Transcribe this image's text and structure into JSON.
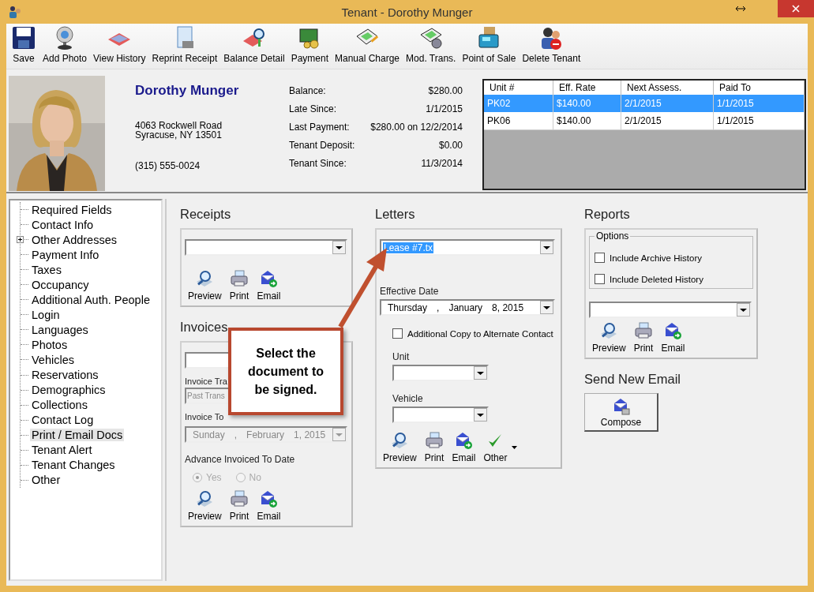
{
  "window": {
    "title": "Tenant - Dorothy Munger"
  },
  "toolbar": [
    {
      "label": "Save"
    },
    {
      "label": "Add Photo"
    },
    {
      "label": "View History"
    },
    {
      "label": "Reprint Receipt"
    },
    {
      "label": "Balance Detail"
    },
    {
      "label": "Payment"
    },
    {
      "label": "Manual Charge"
    },
    {
      "label": "Mod. Trans."
    },
    {
      "label": "Point of Sale"
    },
    {
      "label": "Delete Tenant"
    }
  ],
  "tenant": {
    "name": "Dorothy Munger",
    "address_lines": [
      "4063 Rockwell Road",
      "Syracuse, NY  13501"
    ],
    "phone": "(315) 555-0024"
  },
  "summary": [
    {
      "label": "Balance:",
      "value": "$280.00"
    },
    {
      "label": "Late Since:",
      "value": "1/1/2015"
    },
    {
      "label": "Last Payment:",
      "value": "$280.00 on 12/2/2014"
    },
    {
      "label": "Tenant Deposit:",
      "value": "$0.00"
    },
    {
      "label": "Tenant Since:",
      "value": "11/3/2014"
    }
  ],
  "units": {
    "columns": [
      "Unit #",
      "Eff. Rate",
      "Next Assess.",
      "Paid To"
    ],
    "rows": [
      {
        "cells": [
          "PK02",
          "$140.00",
          "2/1/2015",
          "1/1/2015"
        ],
        "selected": true
      },
      {
        "cells": [
          "PK06",
          "$140.00",
          "2/1/2015",
          "1/1/2015"
        ],
        "selected": false
      }
    ]
  },
  "tree": {
    "items": [
      {
        "label": "Required Fields",
        "kind": "leaf",
        "selected": false
      },
      {
        "label": "Contact Info",
        "kind": "leaf",
        "selected": false
      },
      {
        "label": "Other Addresses",
        "kind": "folder",
        "selected": false
      },
      {
        "label": "Payment Info",
        "kind": "leaf",
        "selected": false
      },
      {
        "label": "Taxes",
        "kind": "leaf",
        "selected": false
      },
      {
        "label": "Occupancy",
        "kind": "leaf",
        "selected": false
      },
      {
        "label": "Additional Auth. People",
        "kind": "leaf",
        "selected": false
      },
      {
        "label": "Login",
        "kind": "leaf",
        "selected": false
      },
      {
        "label": "Languages",
        "kind": "leaf",
        "selected": false
      },
      {
        "label": "Photos",
        "kind": "leaf",
        "selected": false
      },
      {
        "label": "Vehicles",
        "kind": "leaf",
        "selected": false
      },
      {
        "label": "Reservations",
        "kind": "leaf",
        "selected": false
      },
      {
        "label": "Demographics",
        "kind": "leaf",
        "selected": false
      },
      {
        "label": "Collections",
        "kind": "leaf",
        "selected": false
      },
      {
        "label": "Contact Log",
        "kind": "leaf",
        "selected": false
      },
      {
        "label": "Print / Email Docs",
        "kind": "leaf",
        "selected": true
      },
      {
        "label": "Tenant Alert",
        "kind": "leaf",
        "selected": false
      },
      {
        "label": "Tenant Changes",
        "kind": "leaf",
        "selected": false
      },
      {
        "label": "Other",
        "kind": "leaf",
        "selected": false
      }
    ]
  },
  "receipts": {
    "title": "Receipts",
    "buttons": [
      {
        "label": "Preview",
        "kind": "preview"
      },
      {
        "label": "Print",
        "kind": "print"
      },
      {
        "label": "Email",
        "kind": "email"
      }
    ]
  },
  "invoices": {
    "title": "Invoices",
    "transaction_label": "Invoice Tra",
    "transaction_field": {
      "value": "Past Trans",
      "disabled": true
    },
    "to_label": "Invoice To",
    "to_date": {
      "parts": [
        "Sunday",
        ",",
        "February",
        "1, 2015"
      ],
      "disabled": true
    },
    "advance_label": "Advance Invoiced To Date",
    "radios": [
      {
        "label": "Yes",
        "selected": true,
        "disabled": true
      },
      {
        "label": "No",
        "selected": false,
        "disabled": true
      }
    ],
    "buttons": [
      {
        "label": "Preview",
        "kind": "preview"
      },
      {
        "label": "Print",
        "kind": "print"
      },
      {
        "label": "Email",
        "kind": "email"
      }
    ]
  },
  "letters": {
    "title": "Letters",
    "document": {
      "value": "Lease #7.tx",
      "highlighted": true
    },
    "effective_label": "Effective Date",
    "effective_date": {
      "parts": [
        "Thursday",
        ",",
        "January",
        "8, 2015"
      ],
      "disabled": false
    },
    "alternate_copy": {
      "label": "Additional Copy to Alternate Contact",
      "checked": false
    },
    "unit_label": "Unit",
    "vehicle_label": "Vehicle",
    "buttons": [
      {
        "label": "Preview",
        "kind": "preview"
      },
      {
        "label": "Print",
        "kind": "print"
      },
      {
        "label": "Email",
        "kind": "email"
      },
      {
        "label": "Other",
        "kind": "other"
      }
    ]
  },
  "reports": {
    "title": "Reports",
    "options_title": "Options",
    "options": [
      {
        "label": "Include Archive History",
        "checked": false
      },
      {
        "label": "Include Deleted History",
        "checked": false
      }
    ],
    "buttons": [
      {
        "label": "Preview",
        "kind": "preview"
      },
      {
        "label": "Print",
        "kind": "print"
      },
      {
        "label": "Email",
        "kind": "email"
      }
    ]
  },
  "send_email": {
    "title": "Send New Email",
    "button": "Compose"
  },
  "callout": {
    "text": "Select the document to be signed."
  }
}
